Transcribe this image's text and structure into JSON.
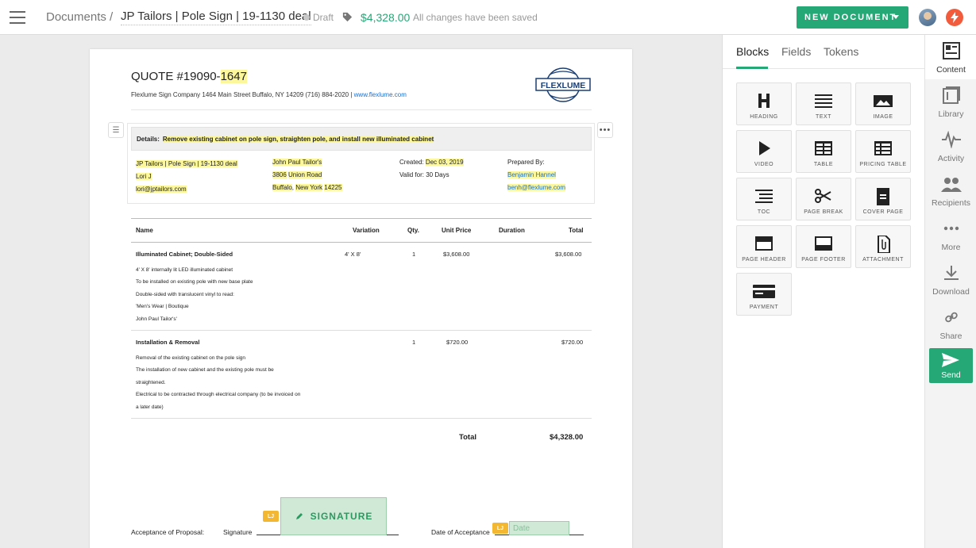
{
  "topbar": {
    "breadcrumb_root": "Documents",
    "breadcrumb_sep": "/",
    "document_title": "JP Tailors | Pole Sign | 19-1130 deal",
    "status": "Draft",
    "amount": "$4,328.00",
    "save_status": "All changes have been saved",
    "new_document_label": "NEW DOCUMENT",
    "colors": {
      "accent": "#25a776",
      "bolt": "#f25c3d"
    }
  },
  "document": {
    "quote_prefix": "QUOTE #19090-",
    "quote_number": "1647",
    "company_line": "Flexlume Sign Company 1464 Main Street Buffalo, NY 14209 (716) 884-2020 |",
    "company_web": "www.flexlume.com",
    "logo_text": "FLEXLUME",
    "details_label": "Details:",
    "details_text": "Remove existing cabinet on pole sign, straighten pole, and install new illuminated cabinet",
    "client": {
      "deal": "JP Tailors | Pole Sign | 19-1130 deal",
      "contact": "Lori J",
      "email": "lori@jptailors.com"
    },
    "address": {
      "name": "John Paul Tailor's",
      "street_no": "3806",
      "street": "Union Road",
      "city": "Buffalo",
      "state": "New York",
      "zip": "14225"
    },
    "meta": {
      "created_label": "Created:",
      "created_value": "Dec 03, 2019",
      "valid_label": "Valid for:",
      "valid_value": "30 Days"
    },
    "prepared": {
      "label": "Prepared By:",
      "name": "Benjamin Hannel",
      "email": "benh@flexlume.com"
    },
    "table": {
      "headers": [
        "Name",
        "Variation",
        "Qty.",
        "Unit Price",
        "Duration",
        "Total"
      ],
      "rows": [
        {
          "name": "Illuminated Cabinet; Double-Sided",
          "variation": "4' X 8'",
          "qty": "1",
          "unit_price": "$3,608.00",
          "total": "$3,608.00",
          "description": [
            "4' X 8' internally lit LED illuminated cabinet",
            "To be installed on existing pole with new base plate",
            "Double-sided with translucent vinyl to read:",
            "'Men's Wear | Boutique",
            "John Paul Tailor's'"
          ]
        },
        {
          "name": "Installation & Removal",
          "variation": "",
          "qty": "1",
          "unit_price": "$720.00",
          "total": "$720.00",
          "description": [
            "Removal of the existing cabinet on the pole sign",
            "The installation of new cabinet and the existing pole must be",
            "straightened.",
            "Electrical to be contracted through electrical company (to be invoiced on",
            "a later date)"
          ]
        }
      ],
      "total_label": "Total",
      "total_value": "$4,328.00"
    },
    "signature": {
      "acceptance_label": "Acceptance of Proposal:",
      "signature_label": "Signature",
      "signature_field": "SIGNATURE",
      "date_label": "Date of Acceptance",
      "date_placeholder": "Date",
      "tag": "LJ"
    }
  },
  "panel": {
    "tabs": [
      "Blocks",
      "Fields",
      "Tokens"
    ],
    "active_tab": "Blocks",
    "blocks": [
      "HEADING",
      "TEXT",
      "IMAGE",
      "VIDEO",
      "TABLE",
      "PRICING TABLE",
      "TOC",
      "PAGE BREAK",
      "COVER PAGE",
      "PAGE HEADER",
      "PAGE FOOTER",
      "ATTACHMENT",
      "PAYMENT"
    ]
  },
  "sidebar": {
    "items": [
      "Content",
      "Library",
      "Activity",
      "Recipients",
      "More",
      "Download",
      "Share"
    ],
    "send": "Send"
  }
}
